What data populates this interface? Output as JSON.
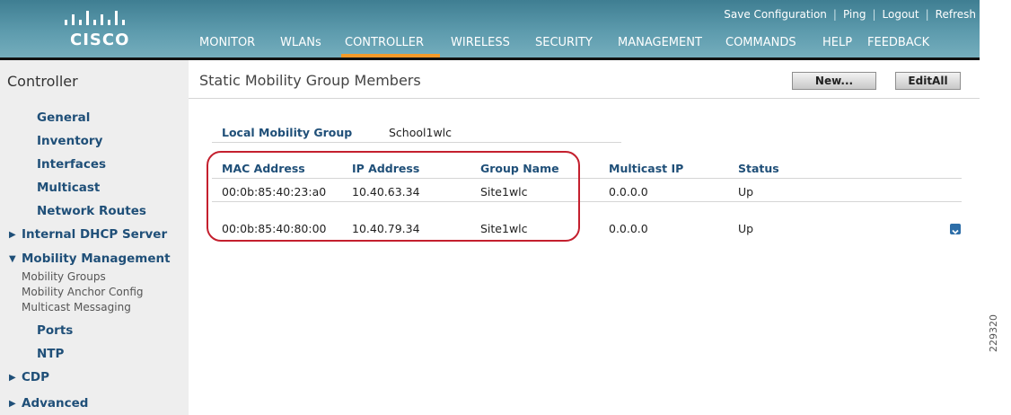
{
  "brand": {
    "name": "CISCO"
  },
  "top_links": [
    "Save Configuration",
    "Ping",
    "Logout",
    "Refresh"
  ],
  "main_nav": [
    {
      "label": "MONITOR"
    },
    {
      "label": "WLANs"
    },
    {
      "label": "CONTROLLER",
      "active": true
    },
    {
      "label": "WIRELESS"
    },
    {
      "label": "SECURITY"
    },
    {
      "label": "MANAGEMENT"
    },
    {
      "label": "COMMANDS"
    },
    {
      "label": "HELP"
    },
    {
      "label": "FEEDBACK"
    }
  ],
  "sidebar": {
    "title": "Controller",
    "items": [
      {
        "label": "General"
      },
      {
        "label": "Inventory"
      },
      {
        "label": "Interfaces"
      },
      {
        "label": "Multicast"
      },
      {
        "label": "Network Routes"
      },
      {
        "label": "Internal DHCP Server",
        "expander": "collapsed"
      },
      {
        "label": "Mobility Management",
        "expander": "expanded",
        "children": [
          {
            "label": "Mobility Groups"
          },
          {
            "label": "Mobility Anchor Config"
          },
          {
            "label": "Multicast Messaging"
          }
        ]
      },
      {
        "label": "Ports"
      },
      {
        "label": "NTP"
      },
      {
        "label": "CDP",
        "expander": "collapsed"
      },
      {
        "label": "Advanced",
        "expander": "collapsed"
      }
    ]
  },
  "page": {
    "title": "Static Mobility Group Members",
    "buttons": {
      "new": "New...",
      "edit_all": "EditAll"
    },
    "local_group": {
      "label": "Local Mobility Group",
      "value": "School1wlc"
    }
  },
  "table": {
    "headers": [
      "MAC Address",
      "IP Address",
      "Group Name",
      "Multicast IP",
      "Status"
    ],
    "rows": [
      [
        "00:0b:85:40:23:a0",
        "10.40.63.34",
        "Site1wlc",
        "0.0.0.0",
        "Up"
      ],
      [
        "00:0b:85:40:80:00",
        "10.40.79.34",
        "Site1wlc",
        "0.0.0.0",
        "Up"
      ]
    ]
  },
  "figure_id": "229320",
  "colors": {
    "header": "#5d9bad",
    "active_tab": "#f39a2a",
    "link": "#1f4f78",
    "highlight_ring": "#c4202e"
  }
}
